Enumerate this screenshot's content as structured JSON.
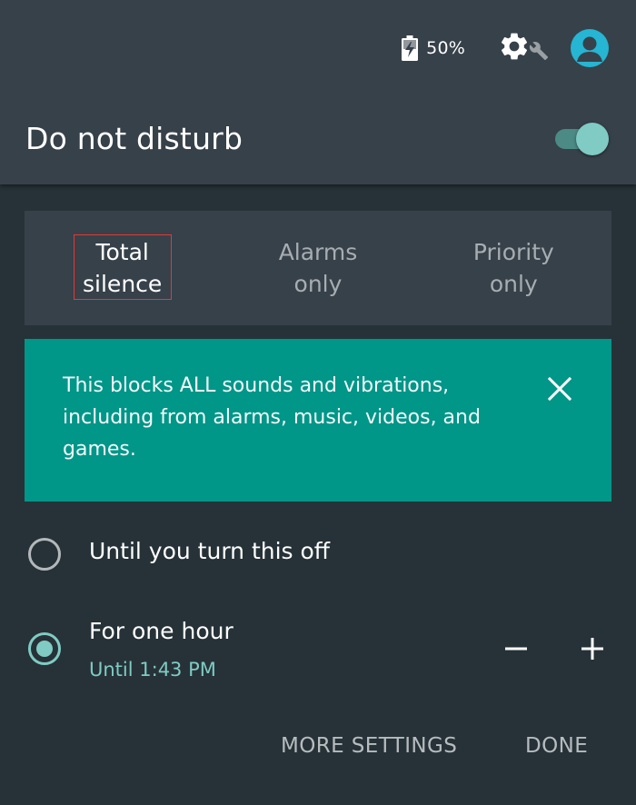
{
  "status_bar": {
    "battery_icon": "battery-charging-icon",
    "battery_percent": "50%",
    "settings_icon": "gear-icon",
    "tool_icon": "wrench-icon",
    "avatar_icon": "account-circle-icon"
  },
  "header": {
    "title": "Do not disturb",
    "toggle_on": true
  },
  "modes": [
    {
      "line1": "Total",
      "line2": "silence",
      "selected": true
    },
    {
      "line1": "Alarms",
      "line2": "only",
      "selected": false
    },
    {
      "line1": "Priority",
      "line2": "only",
      "selected": false
    }
  ],
  "info_card": {
    "text": "This blocks ALL sounds and vibrations, including from alarms, music, videos, and games.",
    "close_icon": "close-icon"
  },
  "options": [
    {
      "label": "Until you turn this off",
      "sublabel": "",
      "selected": false
    },
    {
      "label": "For one hour",
      "sublabel": "Until 1:43 PM",
      "selected": true
    }
  ],
  "stepper": {
    "minus_icon": "minus-icon",
    "plus_icon": "plus-icon"
  },
  "actions": {
    "more_settings": "MORE SETTINGS",
    "done": "DONE"
  },
  "colors": {
    "background": "#263238",
    "header": "#37414a",
    "accent": "#80cbc4",
    "info_card": "#009688"
  }
}
